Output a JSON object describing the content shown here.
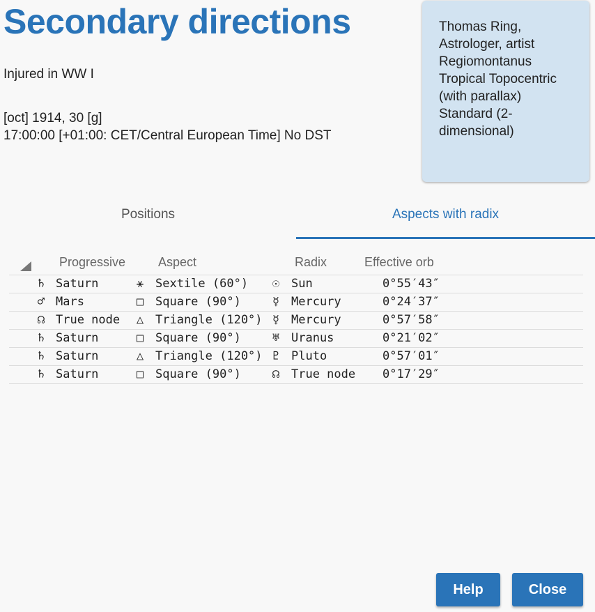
{
  "title": "Secondary directions",
  "event": "Injured in WW I",
  "date_line": "[oct] 1914, 30 [g]",
  "time_line": "17:00:00 [+01:00: CET/Central European Time] No DST",
  "info": {
    "line1": "Thomas Ring,",
    "line2": "Astrologer, artist",
    "line3": "Regiomontanus",
    "line4": "Tropical Topocentric",
    "line5": "(with parallax)",
    "line6": "Standard (2-",
    "line7": "dimensional)"
  },
  "tabs": [
    {
      "label": "Positions"
    },
    {
      "label": "Aspects with radix"
    }
  ],
  "table": {
    "headers": {
      "progressive": "Progressive",
      "aspect": "Aspect",
      "radix": "Radix",
      "orb": "Effective orb"
    },
    "rows": [
      {
        "p_sym": "♄",
        "p_name": "Saturn",
        "a_sym": "⚹",
        "a_name": "Sextile (60°)",
        "r_sym": "☉",
        "r_name": "Sun",
        "orb": "0°55′43″"
      },
      {
        "p_sym": "♂",
        "p_name": "Mars",
        "a_sym": "□",
        "a_name": "Square (90°)",
        "r_sym": "☿",
        "r_name": "Mercury",
        "orb": "0°24′37″"
      },
      {
        "p_sym": "☊",
        "p_name": "True node",
        "a_sym": "△",
        "a_name": "Triangle (120°)",
        "r_sym": "☿",
        "r_name": "Mercury",
        "orb": "0°57′58″"
      },
      {
        "p_sym": "♄",
        "p_name": "Saturn",
        "a_sym": "□",
        "a_name": "Square (90°)",
        "r_sym": "♅",
        "r_name": "Uranus",
        "orb": "0°21′02″"
      },
      {
        "p_sym": "♄",
        "p_name": "Saturn",
        "a_sym": "△",
        "a_name": "Triangle (120°)",
        "r_sym": "♇",
        "r_name": "Pluto",
        "orb": "0°57′01″"
      },
      {
        "p_sym": "♄",
        "p_name": "Saturn",
        "a_sym": "□",
        "a_name": "Square (90°)",
        "r_sym": "☊",
        "r_name": "True node",
        "orb": "0°17′29″"
      }
    ]
  },
  "buttons": {
    "help": "Help",
    "close": "Close"
  },
  "colors": {
    "accent": "#2a74b8",
    "card": "#d2e3f1"
  }
}
